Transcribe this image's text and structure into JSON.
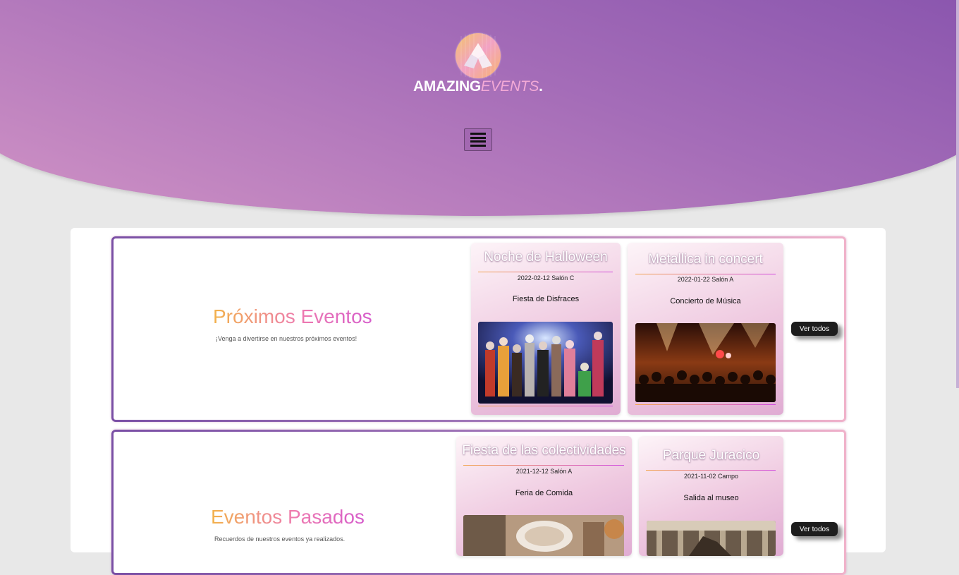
{
  "header": {
    "brand_main": "AMAZING",
    "brand_accent": "EVENTS",
    "brand_dot": ".",
    "menu_icon": "hamburger-menu-icon",
    "colors": {
      "gradient_start": "#8753ad",
      "gradient_end": "#d193c5"
    }
  },
  "upcoming": {
    "title": "Próximos Eventos",
    "subtitle": "¡Venga a divertirse en nuestros próximos eventos!",
    "view_all": "Ver todos",
    "cards": [
      {
        "title": "Noche de Halloween",
        "date": "2022-02-12",
        "place": "Salón C",
        "category": "Fiesta de Disfraces"
      },
      {
        "title": "Metallica in concert",
        "date": "2022-01-22",
        "place": "Salón A",
        "category": "Concierto de Música"
      }
    ]
  },
  "past": {
    "title": "Eventos Pasados",
    "subtitle": "Recuerdos de nuestros eventos ya realizados.",
    "view_all": "Ver todos",
    "cards": [
      {
        "title": "Fiesta de las colectividades",
        "date": "2021-12-12",
        "place": "Salón A",
        "category": "Feria de Comida"
      },
      {
        "title": "Parque Juracico",
        "date": "2021-11-02",
        "place": "Campo",
        "category": "Salida al museo"
      }
    ]
  }
}
